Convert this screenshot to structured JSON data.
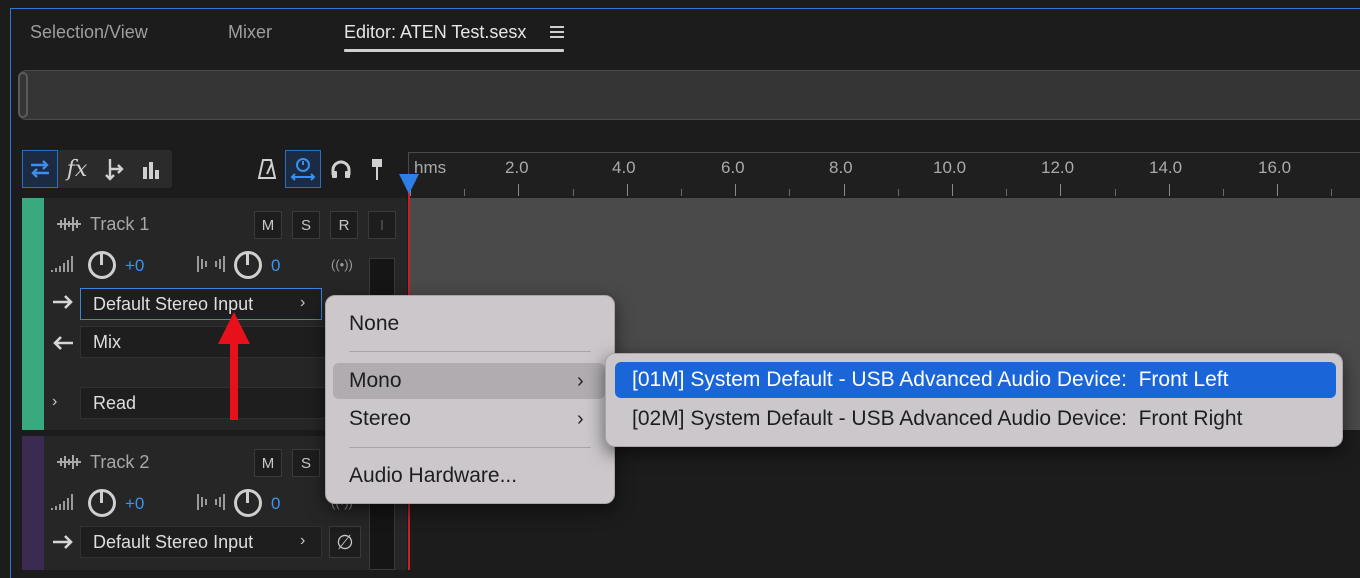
{
  "tabs": [
    {
      "label": "Selection/View"
    },
    {
      "label": "Mixer"
    },
    {
      "label": "Editor: ATEN Test.sesx"
    }
  ],
  "ruler": {
    "unit": "hms",
    "ticks": [
      "2.0",
      "4.0",
      "6.0",
      "8.0",
      "10.0",
      "12.0",
      "14.0",
      "16.0"
    ]
  },
  "tracks": [
    {
      "name": "Track 1",
      "color": "#3ba97f",
      "mute": "M",
      "solo": "S",
      "record": "R",
      "monitor": "I",
      "volume": "+0",
      "pan": "0",
      "input": "Default Stereo Input",
      "output": "Mix",
      "automation": "Read"
    },
    {
      "name": "Track 2",
      "color": "#3b2a52",
      "mute": "M",
      "solo": "S",
      "volume": "+0",
      "pan": "0",
      "input": "Default Stereo Input"
    }
  ],
  "input_menu": {
    "items": [
      "None",
      "Mono",
      "Stereo",
      "Audio Hardware..."
    ],
    "hovered": "Mono"
  },
  "mono_submenu": {
    "items": [
      "[01M] System Default - USB Advanced Audio Device:  Front Left",
      "[02M] System Default - USB Advanced Audio Device:  Front Right"
    ],
    "selected": "[01M] System Default - USB Advanced Audio Device:  Front Left"
  },
  "colors": {
    "accent": "#2d7ad6",
    "playhead": "#c8202a",
    "annotation_arrow": "#e8101a",
    "menu_selection": "#1a66d8"
  }
}
